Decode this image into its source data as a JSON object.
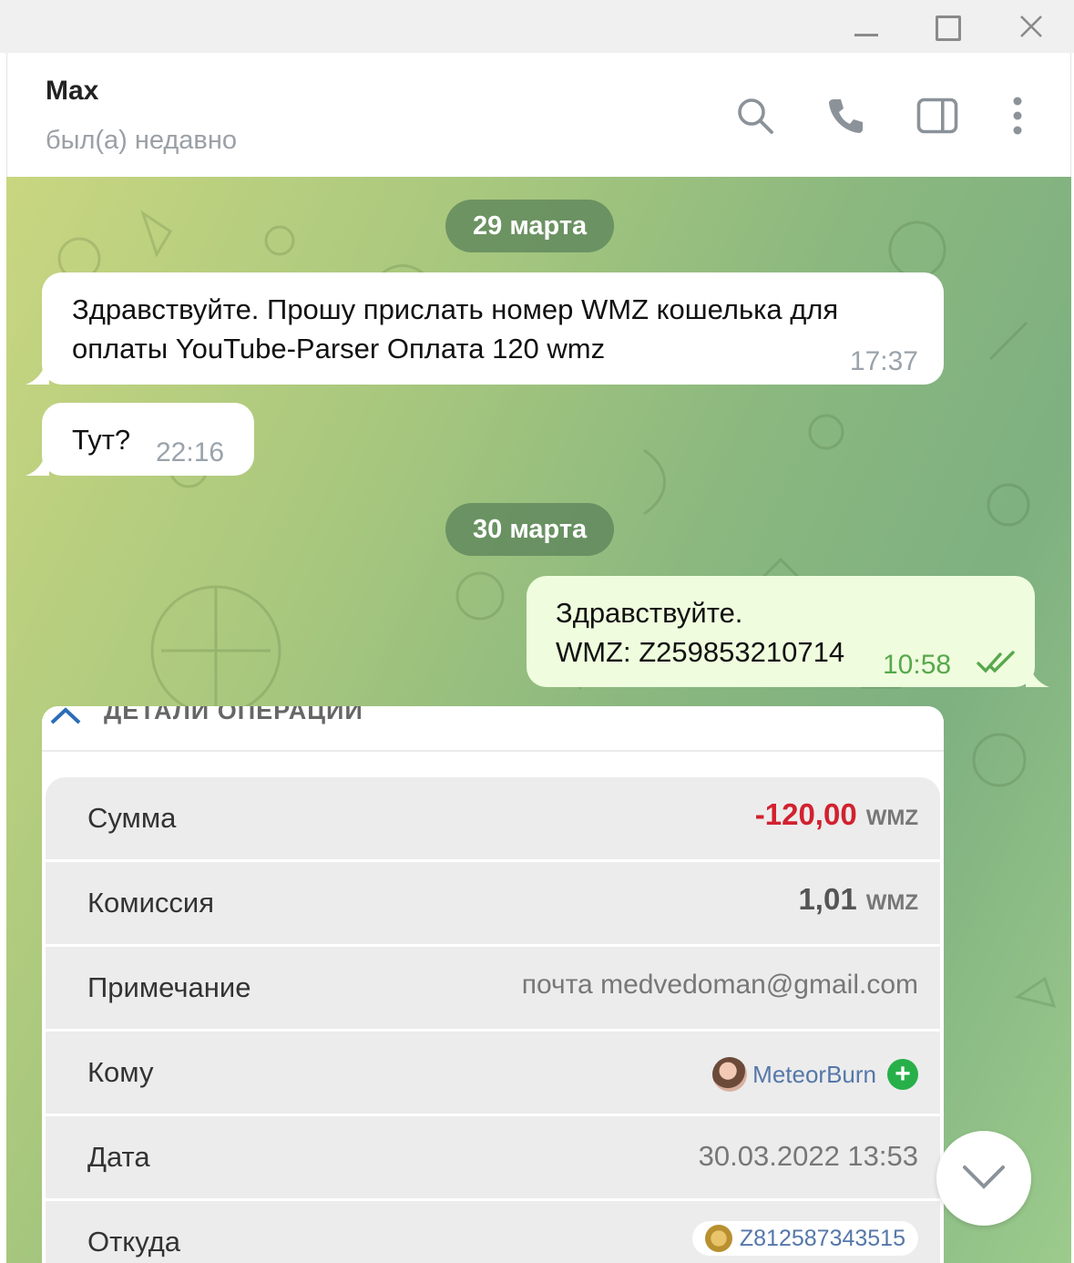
{
  "window": {
    "minimize_icon": "minimize-icon",
    "maximize_icon": "maximize-icon",
    "close_icon": "close-icon"
  },
  "header": {
    "name": "Max",
    "status": "был(а) недавно",
    "icons": [
      "search-icon",
      "phone-icon",
      "sidebar-toggle-icon",
      "more-vertical-icon"
    ]
  },
  "messages": {
    "date1": "29 марта",
    "m1_line1": "Здравствуйте. Прошу прислать номер WMZ кошелька для",
    "m1_line2": "оплаты YouTube-Parser  Оплата 120 wmz",
    "m1_time": "17:37",
    "m2_text": "Тут?",
    "m2_time": "22:16",
    "date2": "30 марта",
    "m3_line1": "Здравствуйте.",
    "m3_line2": "WMZ: Z259853210714",
    "m3_time": "10:58"
  },
  "card": {
    "title": "ДЕТАЛИ ОПЕРАЦИИ",
    "rows": {
      "sum_label": "Сумма",
      "sum_value": "-120,00",
      "sum_unit": "WMZ",
      "fee_label": "Комиссия",
      "fee_value": "1,01",
      "fee_unit": "WMZ",
      "note_label": "Примечание",
      "note_value": "почта medvedoman@gmail.com",
      "to_label": "Кому",
      "to_value": "MeteorBurn",
      "date_label": "Дата",
      "date_value": "30.03.2022 13:53",
      "from_label": "Откуда",
      "from_value": "Z812587343515"
    }
  },
  "colors": {
    "amount_negative": "#d2212f",
    "outgoing_bubble": "#effdde",
    "read_check": "#58a84d"
  }
}
